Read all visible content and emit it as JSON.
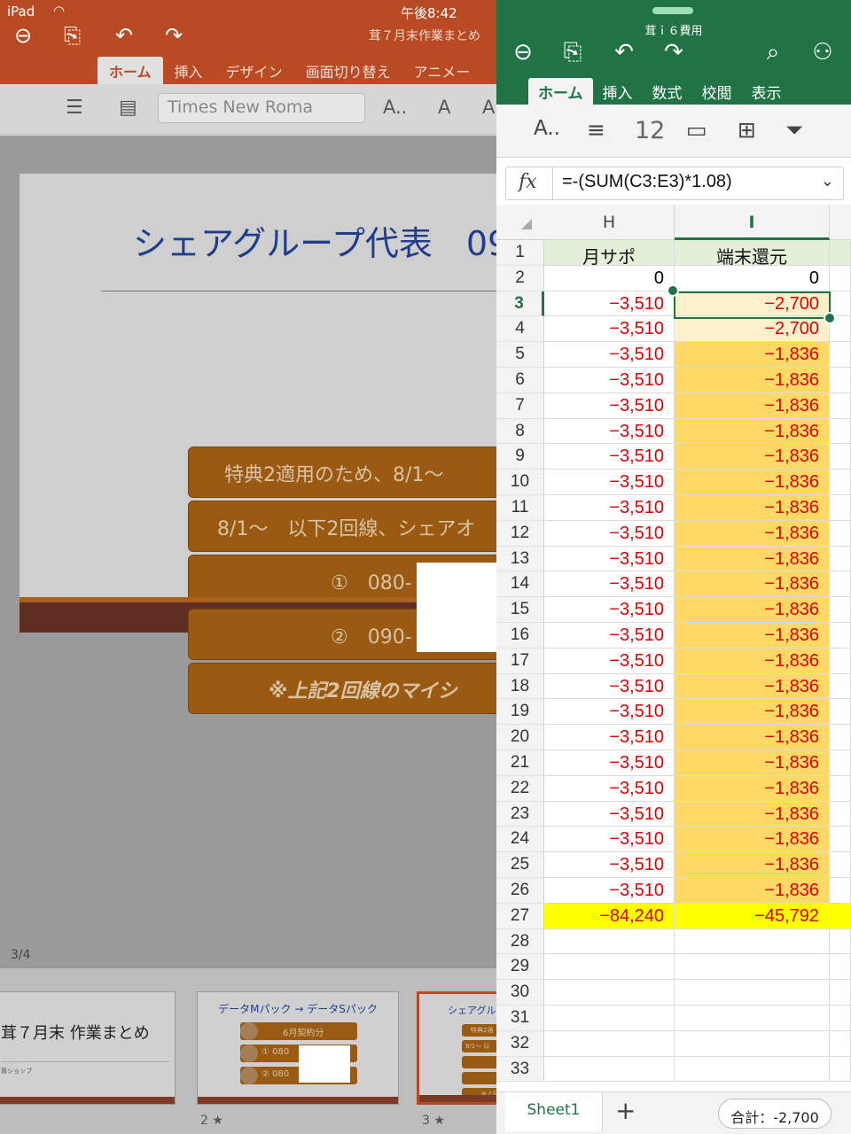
{
  "status_bar": {
    "device": "iPad",
    "time": "午後8:42"
  },
  "powerpoint": {
    "doc_title": "茸７月末作業まとめ",
    "tabs": [
      "ホーム",
      "挿入",
      "デザイン",
      "画面切り替え",
      "アニメー"
    ],
    "font_name": "Times New Roma",
    "slide": {
      "title": "シェアグループ代表　09",
      "boxes": [
        "特典2適用のため、8/1〜",
        "8/1〜　以下2回線、シェアオ",
        "①　080-",
        "②　090-",
        "※上記2回線のマイシ"
      ]
    },
    "slide_counter": "3/4",
    "thumbnails": [
      {
        "title": "茸７月末 作業まとめ",
        "subtitle": "茸ショップ",
        "num": ""
      },
      {
        "title": "データMパック → データSパック",
        "pills": [
          "6月契約分",
          "①  080",
          "②  080"
        ],
        "num": "2 ★"
      },
      {
        "title": "シェアグル",
        "pills": [
          "特典2適",
          "8/1〜 以",
          "",
          "",
          "※上記"
        ],
        "num": "3 ★"
      }
    ]
  },
  "excel": {
    "doc_title": "茸ｉ６費用",
    "tabs": [
      "ホーム",
      "挿入",
      "数式",
      "校閲",
      "表示"
    ],
    "font_size": "12",
    "formula_label": "fx",
    "formula": "=-(SUM(C3:E3)*1.08)",
    "columns": [
      "H",
      "I"
    ],
    "rows": [
      {
        "n": "1",
        "h": "月サポ",
        "i": "端末還元"
      },
      {
        "n": "2",
        "h": "0",
        "i": "0"
      },
      {
        "n": "3",
        "h": "−3,510",
        "i": "−2,700"
      },
      {
        "n": "4",
        "h": "−3,510",
        "i": "−2,700"
      },
      {
        "n": "5",
        "h": "−3,510",
        "i": "−1,836"
      },
      {
        "n": "6",
        "h": "−3,510",
        "i": "−1,836"
      },
      {
        "n": "7",
        "h": "−3,510",
        "i": "−1,836"
      },
      {
        "n": "8",
        "h": "−3,510",
        "i": "−1,836"
      },
      {
        "n": "9",
        "h": "−3,510",
        "i": "−1,836"
      },
      {
        "n": "10",
        "h": "−3,510",
        "i": "−1,836"
      },
      {
        "n": "11",
        "h": "−3,510",
        "i": "−1,836"
      },
      {
        "n": "12",
        "h": "−3,510",
        "i": "−1,836"
      },
      {
        "n": "13",
        "h": "−3,510",
        "i": "−1,836"
      },
      {
        "n": "14",
        "h": "−3,510",
        "i": "−1,836"
      },
      {
        "n": "15",
        "h": "−3,510",
        "i": "−1,836"
      },
      {
        "n": "16",
        "h": "−3,510",
        "i": "−1,836"
      },
      {
        "n": "17",
        "h": "−3,510",
        "i": "−1,836"
      },
      {
        "n": "18",
        "h": "−3,510",
        "i": "−1,836"
      },
      {
        "n": "19",
        "h": "−3,510",
        "i": "−1,836"
      },
      {
        "n": "20",
        "h": "−3,510",
        "i": "−1,836"
      },
      {
        "n": "21",
        "h": "−3,510",
        "i": "−1,836"
      },
      {
        "n": "22",
        "h": "−3,510",
        "i": "−1,836"
      },
      {
        "n": "23",
        "h": "−3,510",
        "i": "−1,836"
      },
      {
        "n": "24",
        "h": "−3,510",
        "i": "−1,836"
      },
      {
        "n": "25",
        "h": "−3,510",
        "i": "−1,836"
      },
      {
        "n": "26",
        "h": "−3,510",
        "i": "−1,836"
      },
      {
        "n": "27",
        "h": "−84,240",
        "i": "−45,792"
      },
      {
        "n": "28",
        "h": "",
        "i": ""
      },
      {
        "n": "29",
        "h": "",
        "i": ""
      },
      {
        "n": "30",
        "h": "",
        "i": ""
      },
      {
        "n": "31",
        "h": "",
        "i": ""
      },
      {
        "n": "32",
        "h": "",
        "i": ""
      },
      {
        "n": "33",
        "h": "",
        "i": ""
      }
    ],
    "selected_row": "3",
    "selected_col": "I",
    "sheet_tab": "Sheet1",
    "sum_text": "合計：-2,700",
    "colors": {
      "accent": "#217346",
      "negative": "#e00000",
      "header_fill": "#e2f0d9",
      "orange_fill": "#ffd966",
      "total_fill": "#ffff00"
    }
  }
}
